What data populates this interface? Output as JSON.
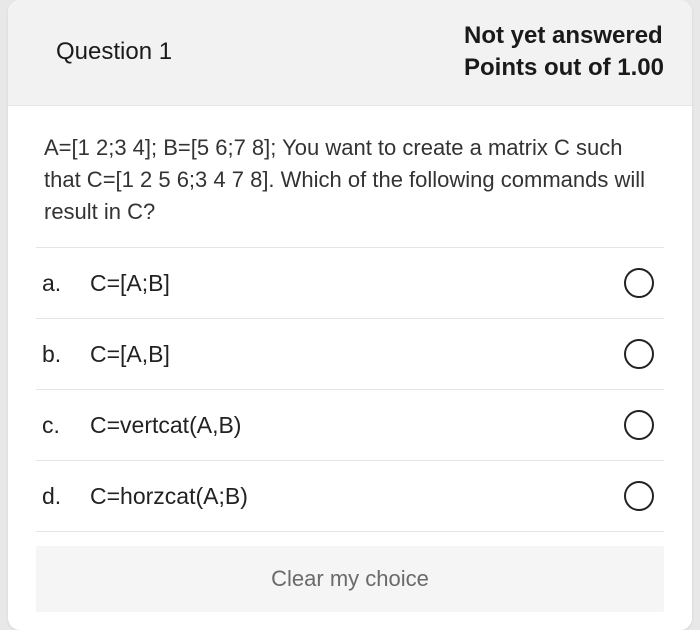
{
  "header": {
    "question_label": "Question 1",
    "status": "Not yet answered",
    "points": "Points out of 1.00"
  },
  "question": {
    "text": "A=[1 2;3 4]; B=[5 6;7 8]; You want to create a matrix C such that C=[1 2 5 6;3 4 7 8]. Which of the following commands will result in C?"
  },
  "options": [
    {
      "letter": "a.",
      "text": "C=[A;B]"
    },
    {
      "letter": "b.",
      "text": "C=[A,B]"
    },
    {
      "letter": "c.",
      "text": "C=vertcat(A,B)"
    },
    {
      "letter": "d.",
      "text": "C=horzcat(A;B)"
    }
  ],
  "clear_label": "Clear my choice"
}
